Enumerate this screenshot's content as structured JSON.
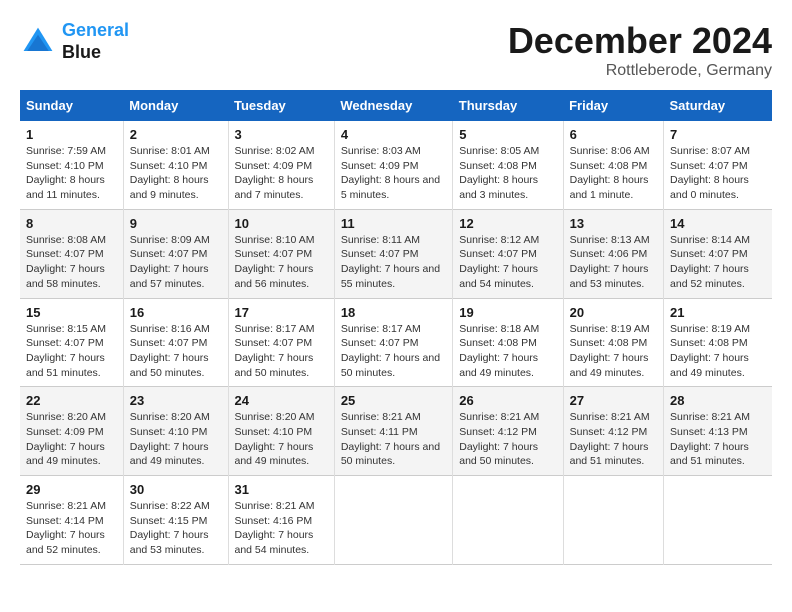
{
  "header": {
    "logo_line1": "General",
    "logo_line2": "Blue",
    "month": "December 2024",
    "location": "Rottleberode, Germany"
  },
  "weekdays": [
    "Sunday",
    "Monday",
    "Tuesday",
    "Wednesday",
    "Thursday",
    "Friday",
    "Saturday"
  ],
  "weeks": [
    [
      {
        "day": "1",
        "sunrise": "7:59 AM",
        "sunset": "4:10 PM",
        "daylight": "8 hours and 11 minutes."
      },
      {
        "day": "2",
        "sunrise": "8:01 AM",
        "sunset": "4:10 PM",
        "daylight": "8 hours and 9 minutes."
      },
      {
        "day": "3",
        "sunrise": "8:02 AM",
        "sunset": "4:09 PM",
        "daylight": "8 hours and 7 minutes."
      },
      {
        "day": "4",
        "sunrise": "8:03 AM",
        "sunset": "4:09 PM",
        "daylight": "8 hours and 5 minutes."
      },
      {
        "day": "5",
        "sunrise": "8:05 AM",
        "sunset": "4:08 PM",
        "daylight": "8 hours and 3 minutes."
      },
      {
        "day": "6",
        "sunrise": "8:06 AM",
        "sunset": "4:08 PM",
        "daylight": "8 hours and 1 minute."
      },
      {
        "day": "7",
        "sunrise": "8:07 AM",
        "sunset": "4:07 PM",
        "daylight": "8 hours and 0 minutes."
      }
    ],
    [
      {
        "day": "8",
        "sunrise": "8:08 AM",
        "sunset": "4:07 PM",
        "daylight": "7 hours and 58 minutes."
      },
      {
        "day": "9",
        "sunrise": "8:09 AM",
        "sunset": "4:07 PM",
        "daylight": "7 hours and 57 minutes."
      },
      {
        "day": "10",
        "sunrise": "8:10 AM",
        "sunset": "4:07 PM",
        "daylight": "7 hours and 56 minutes."
      },
      {
        "day": "11",
        "sunrise": "8:11 AM",
        "sunset": "4:07 PM",
        "daylight": "7 hours and 55 minutes."
      },
      {
        "day": "12",
        "sunrise": "8:12 AM",
        "sunset": "4:07 PM",
        "daylight": "7 hours and 54 minutes."
      },
      {
        "day": "13",
        "sunrise": "8:13 AM",
        "sunset": "4:06 PM",
        "daylight": "7 hours and 53 minutes."
      },
      {
        "day": "14",
        "sunrise": "8:14 AM",
        "sunset": "4:07 PM",
        "daylight": "7 hours and 52 minutes."
      }
    ],
    [
      {
        "day": "15",
        "sunrise": "8:15 AM",
        "sunset": "4:07 PM",
        "daylight": "7 hours and 51 minutes."
      },
      {
        "day": "16",
        "sunrise": "8:16 AM",
        "sunset": "4:07 PM",
        "daylight": "7 hours and 50 minutes."
      },
      {
        "day": "17",
        "sunrise": "8:17 AM",
        "sunset": "4:07 PM",
        "daylight": "7 hours and 50 minutes."
      },
      {
        "day": "18",
        "sunrise": "8:17 AM",
        "sunset": "4:07 PM",
        "daylight": "7 hours and 50 minutes."
      },
      {
        "day": "19",
        "sunrise": "8:18 AM",
        "sunset": "4:08 PM",
        "daylight": "7 hours and 49 minutes."
      },
      {
        "day": "20",
        "sunrise": "8:19 AM",
        "sunset": "4:08 PM",
        "daylight": "7 hours and 49 minutes."
      },
      {
        "day": "21",
        "sunrise": "8:19 AM",
        "sunset": "4:08 PM",
        "daylight": "7 hours and 49 minutes."
      }
    ],
    [
      {
        "day": "22",
        "sunrise": "8:20 AM",
        "sunset": "4:09 PM",
        "daylight": "7 hours and 49 minutes."
      },
      {
        "day": "23",
        "sunrise": "8:20 AM",
        "sunset": "4:10 PM",
        "daylight": "7 hours and 49 minutes."
      },
      {
        "day": "24",
        "sunrise": "8:20 AM",
        "sunset": "4:10 PM",
        "daylight": "7 hours and 49 minutes."
      },
      {
        "day": "25",
        "sunrise": "8:21 AM",
        "sunset": "4:11 PM",
        "daylight": "7 hours and 50 minutes."
      },
      {
        "day": "26",
        "sunrise": "8:21 AM",
        "sunset": "4:12 PM",
        "daylight": "7 hours and 50 minutes."
      },
      {
        "day": "27",
        "sunrise": "8:21 AM",
        "sunset": "4:12 PM",
        "daylight": "7 hours and 51 minutes."
      },
      {
        "day": "28",
        "sunrise": "8:21 AM",
        "sunset": "4:13 PM",
        "daylight": "7 hours and 51 minutes."
      }
    ],
    [
      {
        "day": "29",
        "sunrise": "8:21 AM",
        "sunset": "4:14 PM",
        "daylight": "7 hours and 52 minutes."
      },
      {
        "day": "30",
        "sunrise": "8:22 AM",
        "sunset": "4:15 PM",
        "daylight": "7 hours and 53 minutes."
      },
      {
        "day": "31",
        "sunrise": "8:21 AM",
        "sunset": "4:16 PM",
        "daylight": "7 hours and 54 minutes."
      },
      null,
      null,
      null,
      null
    ]
  ]
}
